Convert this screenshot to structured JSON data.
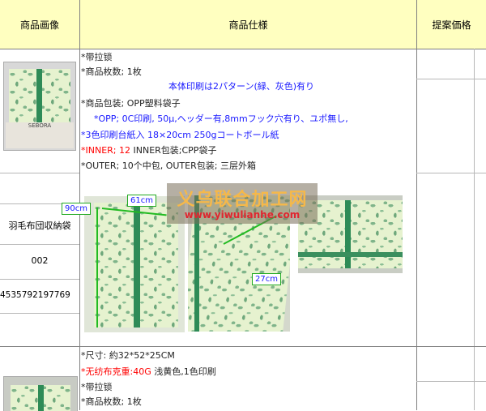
{
  "headers": {
    "image": "商品画像",
    "spec": "商品仕様",
    "price": "提案価格"
  },
  "product1": {
    "name": "羽毛布団収納袋",
    "number": "002",
    "barcode": "4535792197769",
    "package_label": "SEBORA",
    "spec_lines": [
      "*带拉锁",
      "*商品枚数; 1枚",
      "本体印刷は2パターン(緑、灰色)有り",
      "*商品包装; OPP塑料袋子",
      "*OPP; 0C印刷, 50μ,ヘッダー有,8mmフック穴有り、ユポ無し,",
      "*3色印刷台紙入 18×20cm 250gコートボール紙",
      "*INNER; 12",
      " INNER包装;CPP袋子",
      "*OUTER; 10个中包, OUTER包装; 三层外箱"
    ],
    "dimensions": {
      "length": "90cm",
      "width": "61cm",
      "depth": "27cm"
    }
  },
  "product2": {
    "spec_lines": [
      "*尺寸: 約32*52*25CM",
      "*无纺布克重:40G",
      " 浅黄色,1色印刷",
      "*带拉锁",
      "*商品枚数; 1枚"
    ]
  },
  "watermark": {
    "title": "义乌联合加工网",
    "url": "www.yiwulianhe.com"
  },
  "colors": {
    "header_bg": "#ffffc0",
    "blue_text": "#1a1aff",
    "red_text": "#ff0000",
    "measure_green": "#22bb22",
    "watermark_red": "#e0262f"
  }
}
